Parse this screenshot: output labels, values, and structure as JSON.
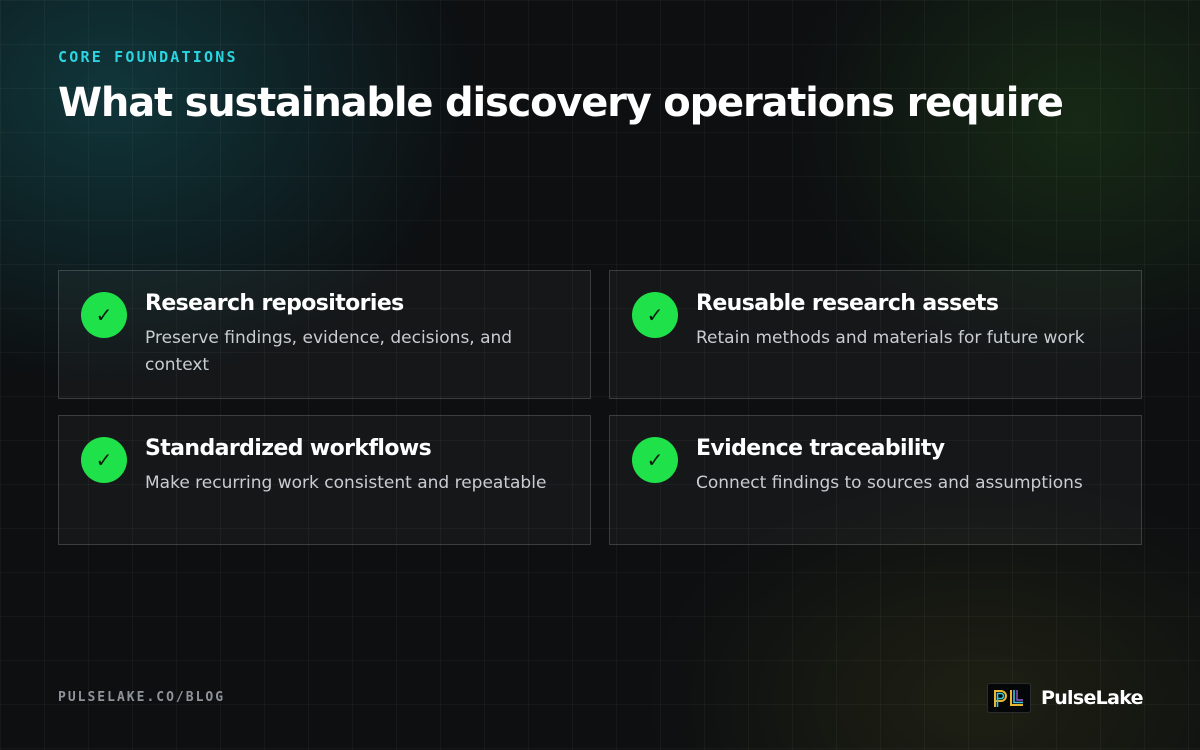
{
  "eyebrow": "CORE FOUNDATIONS",
  "title": "What sustainable discovery operations require",
  "cards": [
    {
      "title": "Research repositories",
      "description": "Preserve findings, evidence, decisions, and context",
      "icon": "check-circle-icon"
    },
    {
      "title": "Reusable research assets",
      "description": "Retain methods and materials for future work",
      "icon": "check-circle-icon"
    },
    {
      "title": "Standardized workflows",
      "description": "Make recurring work consistent and repeatable",
      "icon": "check-circle-icon"
    },
    {
      "title": "Evidence traceability",
      "description": "Connect findings to sources and assumptions",
      "icon": "check-circle-icon"
    }
  ],
  "footer": {
    "url": "PULSELAKE.CO/BLOG",
    "brand_name": "PulseLake"
  },
  "colors": {
    "accent_cyan": "#2ad4e0",
    "check_green": "#1fe24a",
    "background": "#0d0f11"
  }
}
